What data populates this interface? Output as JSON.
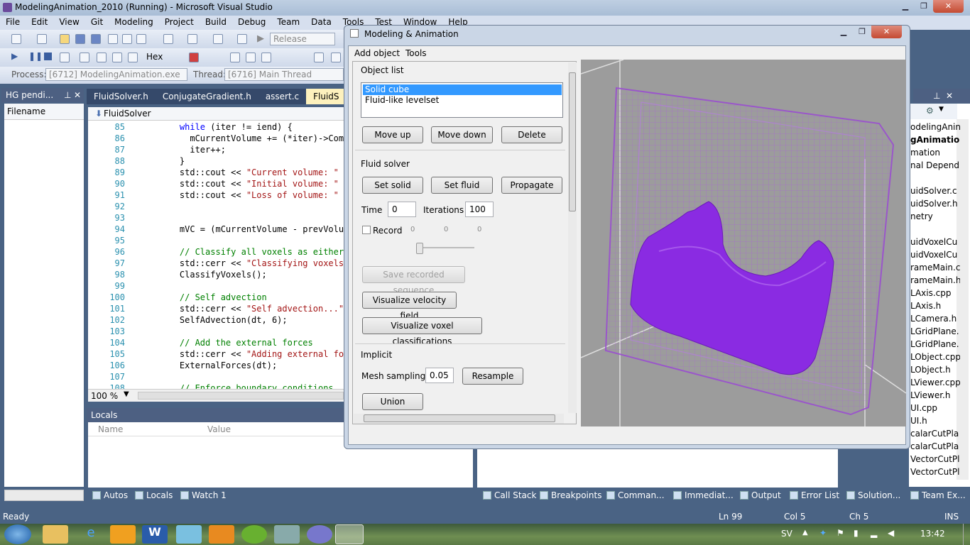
{
  "vs": {
    "title": "ModelingAnimation_2010 (Running) - Microsoft Visual Studio",
    "menu": [
      "File",
      "Edit",
      "View",
      "Git",
      "Modeling",
      "Project",
      "Build",
      "Debug",
      "Team",
      "Data",
      "Tools",
      "Test",
      "Window",
      "Help"
    ],
    "toolbar": {
      "config": "Release",
      "hex": "Hex"
    },
    "debug": {
      "process_label": "Process:",
      "process_value": "[6712] ModelingAnimation.exe",
      "thread_label": "Thread:",
      "thread_value": "[6716] Main Thread"
    },
    "left_panel": {
      "title": "HG pendi...",
      "column": "Filename"
    },
    "tabs": [
      "FluidSolver.h",
      "ConjugateGradient.h",
      "assert.c",
      "FluidS"
    ],
    "nav_dropdown": "FluidSolver",
    "zoom": "100 %",
    "code": [
      {
        "n": "85",
        "t": "    while (iter != iend) {",
        "k": "code"
      },
      {
        "n": "86",
        "t": "      mCurrentVolume += (*iter)->ComputeV",
        "k": "code"
      },
      {
        "n": "87",
        "t": "      iter++;",
        "k": "code"
      },
      {
        "n": "88",
        "t": "    }",
        "k": "code"
      },
      {
        "n": "89",
        "t": "    std::cout << \"Current volume: \" << mC",
        "k": "str"
      },
      {
        "n": "90",
        "t": "    std::cout << \"Initial volume: \" << mI",
        "k": "str"
      },
      {
        "n": "91",
        "t": "    std::cout << \"Loss of volume: \" << mI",
        "k": "str"
      },
      {
        "n": "92",
        "t": "",
        "k": "code"
      },
      {
        "n": "93",
        "t": "",
        "k": "code"
      },
      {
        "n": "94",
        "t": "    mVC = (mCurrentVolume - prevVolume)/m",
        "k": "code"
      },
      {
        "n": "95",
        "t": "",
        "k": "code"
      },
      {
        "n": "96",
        "t": "    // Classify all voxels as either soli",
        "k": "cmt"
      },
      {
        "n": "97",
        "t": "    std::cerr << \"Classifying voxels...\"",
        "k": "str"
      },
      {
        "n": "98",
        "t": "    ClassifyVoxels();",
        "k": "code"
      },
      {
        "n": "99",
        "t": "",
        "k": "code"
      },
      {
        "n": "100",
        "t": "    // Self advection",
        "k": "cmt"
      },
      {
        "n": "101",
        "t": "    std::cerr << \"Self advection...\" << s",
        "k": "str"
      },
      {
        "n": "102",
        "t": "    SelfAdvection(dt, 6);",
        "k": "code"
      },
      {
        "n": "103",
        "t": "",
        "k": "code"
      },
      {
        "n": "104",
        "t": "    // Add the external forces",
        "k": "cmt"
      },
      {
        "n": "105",
        "t": "    std::cerr << \"Adding external forces.",
        "k": "str"
      },
      {
        "n": "106",
        "t": "    ExternalForces(dt);",
        "k": "code"
      },
      {
        "n": "107",
        "t": "",
        "k": "code"
      },
      {
        "n": "108",
        "t": "    // Enforce boundary conditions",
        "k": "cmt"
      }
    ],
    "locals": {
      "title": "Locals",
      "col_name": "Name",
      "col_value": "Value"
    },
    "bottom_tabs_left": [
      "Autos",
      "Locals",
      "Watch 1"
    ],
    "bottom_tabs_right": [
      "Call Stack",
      "Breakpoints",
      "Comman...",
      "Immediat...",
      "Output",
      "Error List",
      "Solution...",
      "Team Ex..."
    ],
    "solution_items": [
      "odelingAnin",
      "gAnimation",
      "mation",
      "nal Depend",
      "",
      "uidSolver.c",
      "uidSolver.h",
      "netry",
      "",
      "uidVoxelCu",
      "uidVoxelCu",
      "rameMain.c",
      "rameMain.h",
      "LAxis.cpp",
      "LAxis.h",
      "LCamera.h",
      "LGridPlane.",
      "LGridPlane.",
      "LObject.cpp",
      "LObject.h",
      "LViewer.cpp",
      "LViewer.h",
      "UI.cpp",
      "UI.h",
      "calarCutPla",
      "calarCutPla",
      "VectorCutPla",
      "VectorCutPla"
    ],
    "status": {
      "ready": "Ready",
      "ln": "Ln 99",
      "col": "Col 5",
      "ch": "Ch 5",
      "ins": "INS"
    }
  },
  "dialog": {
    "title": "Modeling & Animation",
    "menu": [
      "Add object",
      "Tools"
    ],
    "object_list_label": "Object list",
    "objects": [
      "Solid cube",
      "Fluid-like levelset"
    ],
    "selected_object": "Solid cube",
    "btn_move_up": "Move up",
    "btn_move_down": "Move down",
    "btn_delete": "Delete",
    "fluid_solver_label": "Fluid solver",
    "btn_set_solid": "Set solid",
    "btn_set_fluid": "Set fluid",
    "btn_propagate": "Propagate",
    "time_label": "Time",
    "time_value": "0",
    "iterations_label": "Iterations",
    "iterations_value": "100",
    "record_label": "Record",
    "slider_ticks": [
      "0",
      "0",
      "0"
    ],
    "btn_save_seq": "Save recorded sequence",
    "btn_vis_velocity": "Visualize velocity field",
    "btn_vis_voxel": "Visualize voxel classifications",
    "implicit_label": "Implicit",
    "mesh_sampling_label": "Mesh sampling",
    "mesh_sampling_value": "0.05",
    "btn_resample": "Resample",
    "btn_union": "Union"
  },
  "taskbar": {
    "lang": "SV",
    "time": "13:42"
  },
  "colors": {
    "purple": "#8a2be2",
    "select": "#3399ff"
  }
}
